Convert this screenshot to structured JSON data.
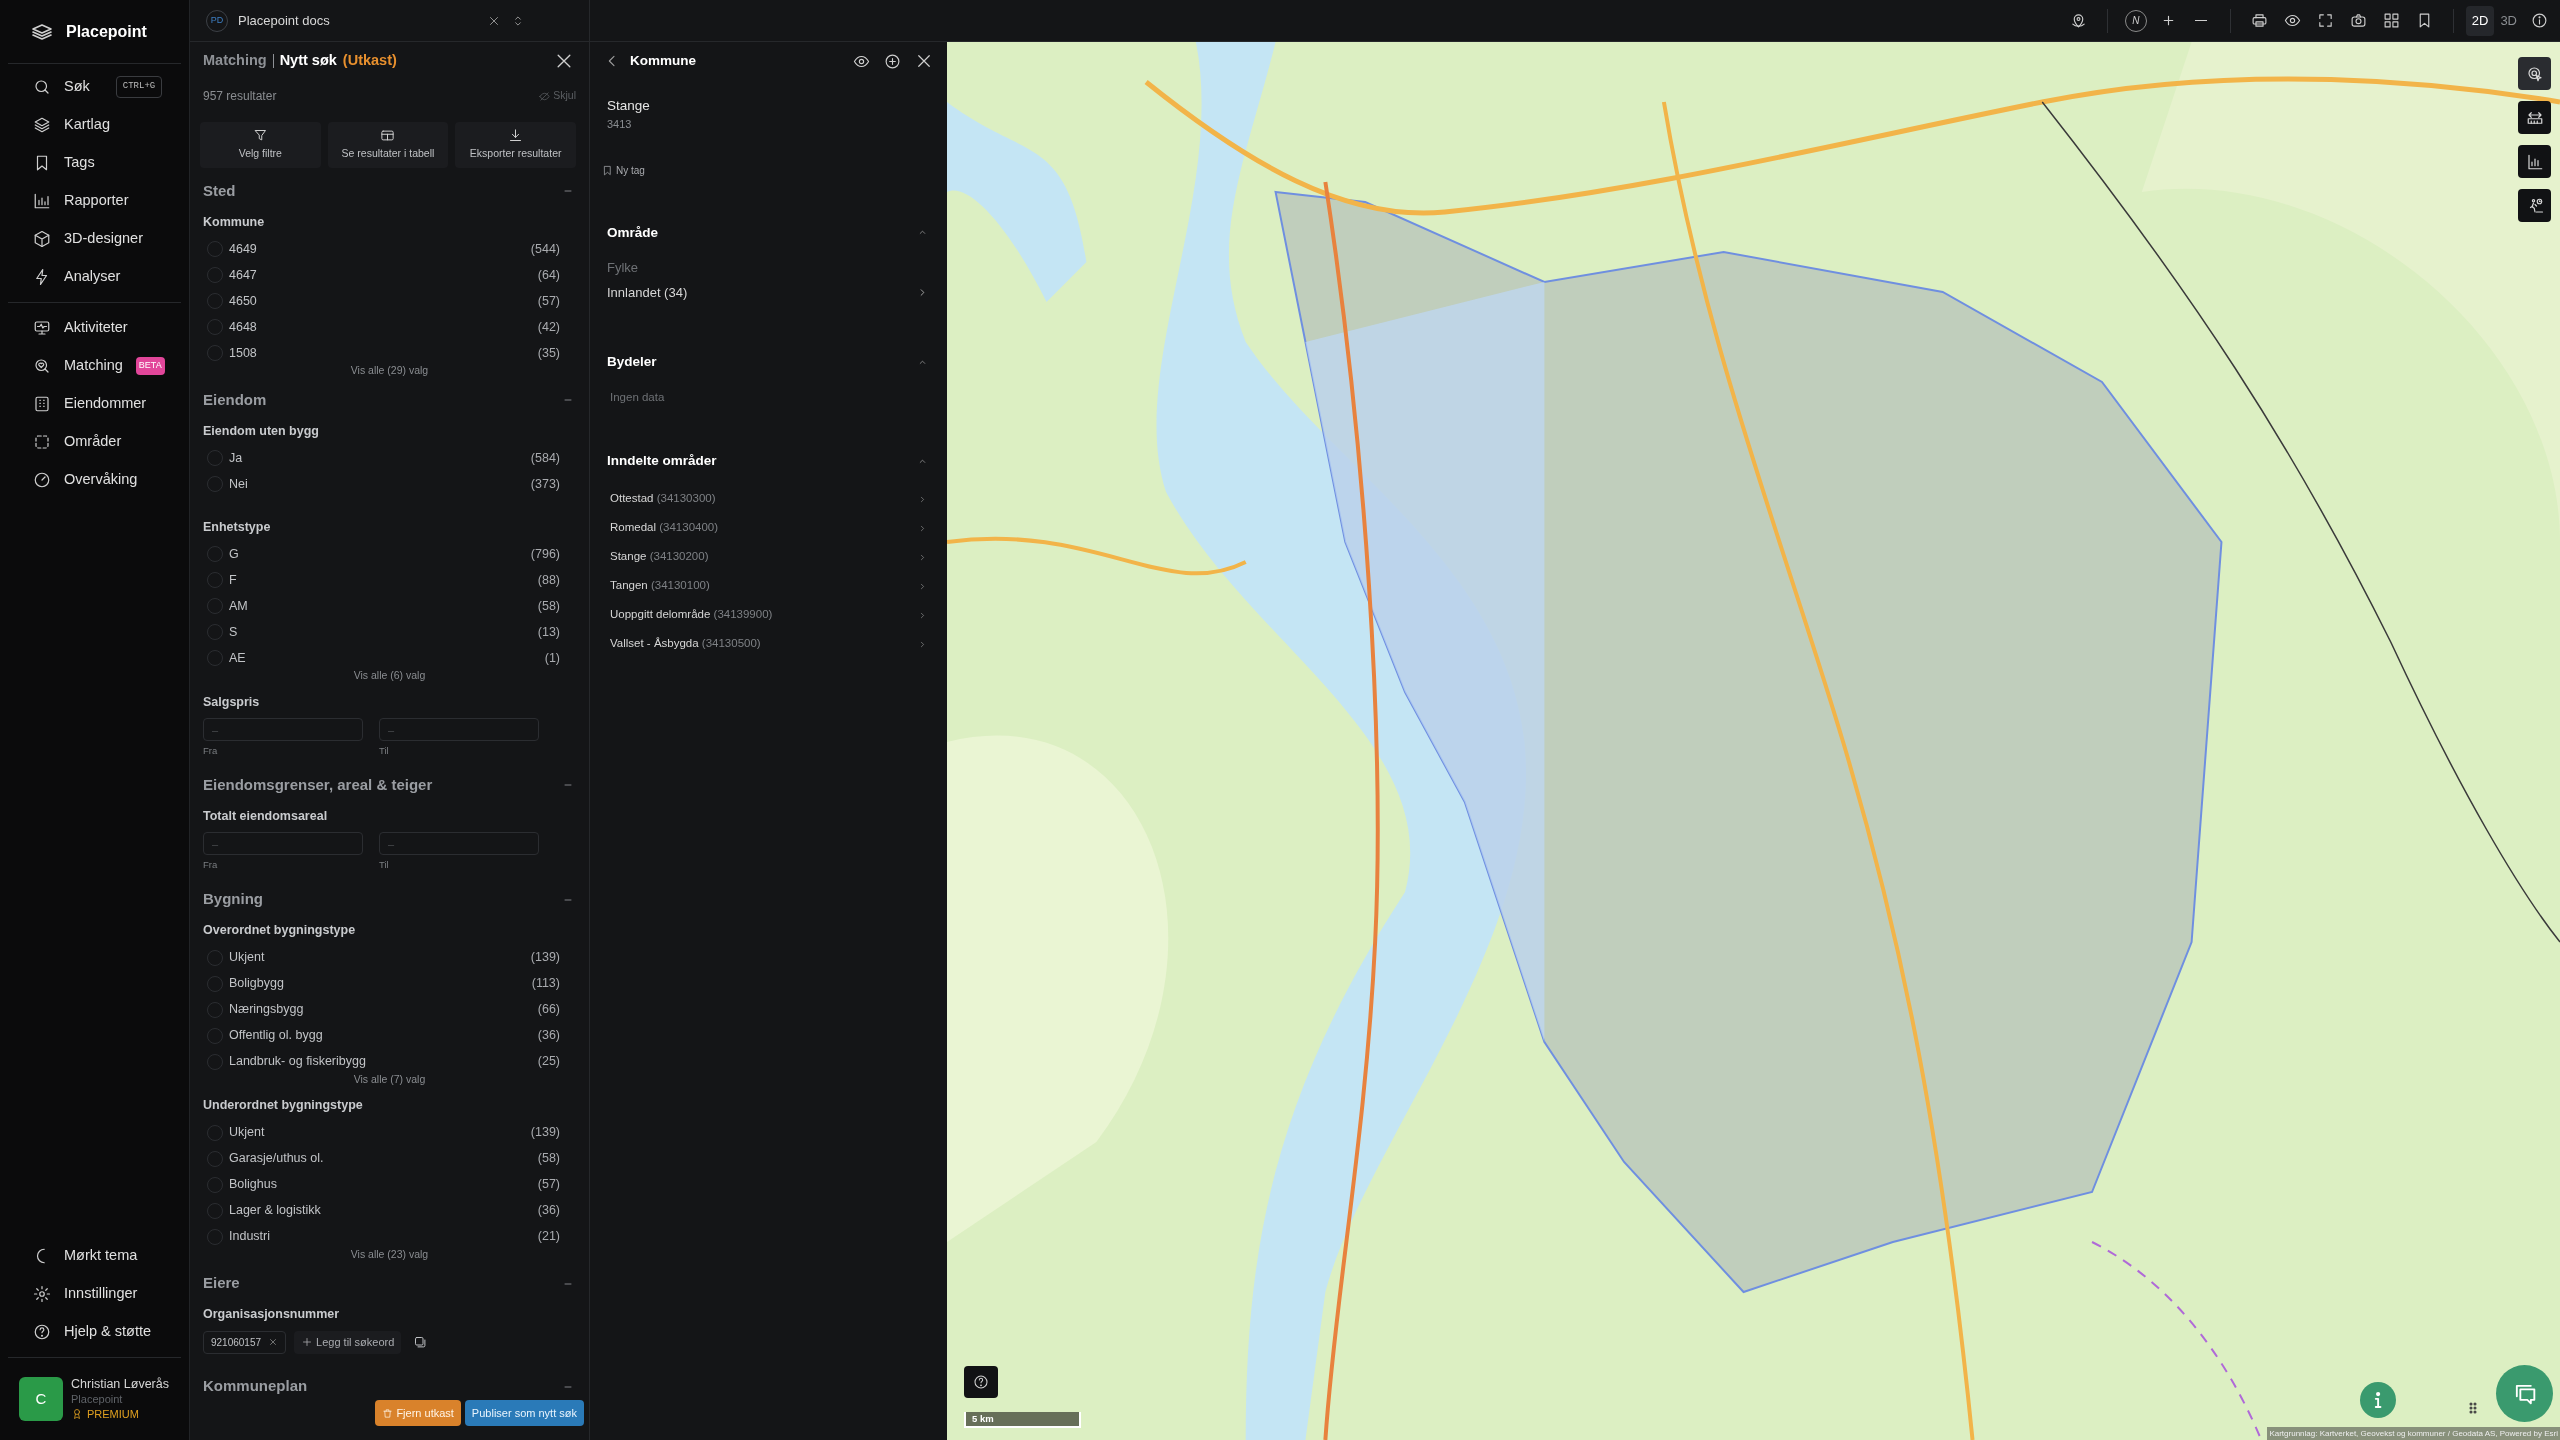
{
  "app": {
    "name": "Placepoint"
  },
  "nav": {
    "main": [
      {
        "label": "Søk",
        "shortcut": "CTRL+G"
      },
      {
        "label": "Kartlag"
      },
      {
        "label": "Tags"
      },
      {
        "label": "Rapporter"
      },
      {
        "label": "3D-designer"
      },
      {
        "label": "Analyser"
      }
    ],
    "secondary": [
      {
        "label": "Aktiviteter"
      },
      {
        "label": "Matching",
        "badge": "BETA"
      },
      {
        "label": "Eiendommer"
      },
      {
        "label": "Områder"
      },
      {
        "label": "Overvåking"
      }
    ],
    "bottom": [
      {
        "label": "Mørkt tema"
      },
      {
        "label": "Innstillinger"
      },
      {
        "label": "Hjelp & støtte"
      }
    ]
  },
  "user": {
    "initial": "C",
    "name": "Christian Løverås",
    "org": "Placepoint",
    "plan": "PREMIUM"
  },
  "tab": {
    "initials": "PD",
    "title": "Placepoint docs"
  },
  "filter_panel": {
    "breadcrumb": "Matching",
    "title": "Nytt søk",
    "status": "(Utkast)",
    "result_count": "957 resultater",
    "hide_label": "Skjul",
    "actions": [
      {
        "label": "Velg filtre"
      },
      {
        "label": "Se resultater i tabell"
      },
      {
        "label": "Eksporter resultater"
      }
    ],
    "sections": [
      {
        "title": "Sted",
        "expanded": true,
        "groups": [
          {
            "kind": "options",
            "label": "Kommune",
            "show_all": "Vis alle (29) valg",
            "options": [
              {
                "label": "4649",
                "count": "(544)",
                "checked": false
              },
              {
                "label": "4647",
                "count": "(64)",
                "checked": false
              },
              {
                "label": "4650",
                "count": "(57)",
                "checked": false
              },
              {
                "label": "4648",
                "count": "(42)",
                "checked": false
              },
              {
                "label": "1508",
                "count": "(35)",
                "checked": false
              }
            ]
          }
        ]
      },
      {
        "title": "Eiendom",
        "expanded": true,
        "groups": [
          {
            "kind": "options",
            "label": "Eiendom uten bygg",
            "options": [
              {
                "label": "Ja",
                "count": "(584)",
                "checked": false
              },
              {
                "label": "Nei",
                "count": "(373)",
                "checked": false
              }
            ]
          },
          {
            "kind": "options",
            "label": "Enhetstype",
            "show_all": "Vis alle (6) valg",
            "options": [
              {
                "label": "G",
                "count": "(796)",
                "checked": false
              },
              {
                "label": "F",
                "count": "(88)",
                "checked": false
              },
              {
                "label": "AM",
                "count": "(58)",
                "checked": false
              },
              {
                "label": "S",
                "count": "(13)",
                "checked": false
              },
              {
                "label": "AE",
                "count": "(1)",
                "checked": false
              }
            ]
          },
          {
            "kind": "range",
            "label": "Salgspris",
            "fields": [
              {
                "placeholder": "–",
                "caption": "Fra"
              },
              {
                "placeholder": "–",
                "caption": "Til"
              }
            ]
          }
        ]
      },
      {
        "title": "Eiendomsgrenser, areal & teiger",
        "expanded": true,
        "groups": [
          {
            "kind": "range",
            "label": "Totalt eiendomsareal",
            "fields": [
              {
                "placeholder": "–",
                "caption": "Fra"
              },
              {
                "placeholder": "–",
                "caption": "Til"
              }
            ]
          }
        ]
      },
      {
        "title": "Bygning",
        "expanded": true,
        "groups": [
          {
            "kind": "options",
            "label": "Overordnet bygningstype",
            "show_all": "Vis alle (7) valg",
            "options": [
              {
                "label": "Ukjent",
                "count": "(139)",
                "checked": false
              },
              {
                "label": "Boligbygg",
                "count": "(113)",
                "checked": false
              },
              {
                "label": "Næringsbygg",
                "count": "(66)",
                "checked": false
              },
              {
                "label": "Offentlig ol. bygg",
                "count": "(36)",
                "checked": false
              },
              {
                "label": "Landbruk- og fiskeribygg",
                "count": "(25)",
                "checked": false
              }
            ]
          },
          {
            "kind": "options",
            "label": "Underordnet bygningstype",
            "show_all": "Vis alle (23) valg",
            "options": [
              {
                "label": "Ukjent",
                "count": "(139)",
                "checked": false
              },
              {
                "label": "Garasje/uthus ol.",
                "count": "(58)",
                "checked": false
              },
              {
                "label": "Bolighus",
                "count": "(57)",
                "checked": false
              },
              {
                "label": "Lager & logistikk",
                "count": "(36)",
                "checked": false
              },
              {
                "label": "Industri",
                "count": "(21)",
                "checked": false
              }
            ]
          }
        ]
      },
      {
        "title": "Eiere",
        "expanded": true,
        "groups": [
          {
            "kind": "tags",
            "label": "Organisasjonsnummer",
            "tags": [
              "921060157"
            ],
            "add_label": "Legg til søkeord"
          }
        ]
      },
      {
        "title": "Kommuneplan",
        "expanded": true
      }
    ],
    "footer_buttons": [
      {
        "label": "Fjern utkast",
        "kind": "danger"
      },
      {
        "label": "Publiser som nytt søk",
        "kind": "primary"
      }
    ]
  },
  "detail_panel": {
    "title": "Kommune",
    "name": "Stange",
    "code": "3413",
    "tag_label": "Ny tag",
    "sections": [
      {
        "title": "Område",
        "expanded": true,
        "kind": "fields",
        "label": "Fylke",
        "items": [
          {
            "name": "Innlandet",
            "code": "(34)"
          }
        ]
      },
      {
        "title": "Bydeler",
        "expanded": true,
        "kind": "empty",
        "text": "Ingen data"
      },
      {
        "title": "Inndelte områder",
        "expanded": true,
        "kind": "list",
        "items": [
          {
            "name": "Ottestad",
            "code": "(34130300)"
          },
          {
            "name": "Romedal",
            "code": "(34130400)"
          },
          {
            "name": "Stange",
            "code": "(34130200)"
          },
          {
            "name": "Tangen",
            "code": "(34130100)"
          },
          {
            "name": "Uoppgitt delområde",
            "code": "(34139900)"
          },
          {
            "name": "Vallset - Åsbygda",
            "code": "(34130500)"
          }
        ]
      }
    ]
  },
  "map_toolbar": {
    "compass": "N",
    "view_modes": [
      {
        "label": "2D",
        "selected": true
      },
      {
        "label": "3D",
        "selected": false
      }
    ]
  },
  "map": {
    "scale": "5 km",
    "attribution": "Kartgrunnlag: Kartverket, Geovekst og kommuner / Geodata AS, Powered by Esri"
  }
}
